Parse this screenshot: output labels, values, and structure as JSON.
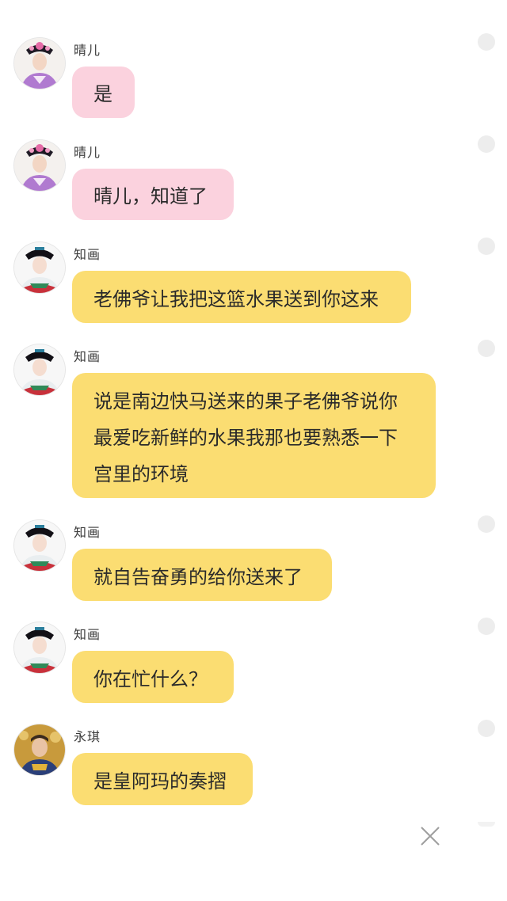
{
  "messages": [
    {
      "sender": "晴儿",
      "text": "是",
      "color": "#fbd2de",
      "avatar": "qinger-avatar"
    },
    {
      "sender": "晴儿",
      "text": "晴儿，知道了",
      "color": "#fbd2de",
      "avatar": "qinger-avatar"
    },
    {
      "sender": "知画",
      "text": "老佛爷让我把这篮水果送到你这来",
      "color": "#fbdd72",
      "avatar": "zhihua-avatar"
    },
    {
      "sender": "知画",
      "lines": [
        "说是南边快马送来的果子老佛爷说你",
        "最爱吃新鲜的水果我那也要熟悉一下",
        "宫里的环境"
      ],
      "color": "#fbdd72",
      "avatar": "zhihua-avatar"
    },
    {
      "sender": "知画",
      "text": "就自告奋勇的给你送来了",
      "color": "#fbdd72",
      "avatar": "zhihua-avatar"
    },
    {
      "sender": "知画",
      "text": "你在忙什么？",
      "color": "#fbdd72",
      "avatar": "zhihua-avatar"
    },
    {
      "sender": "永琪",
      "text": "是皇阿玛的奏摺",
      "color": "#fbdd72",
      "avatar": "yongqi-avatar"
    }
  ],
  "close": {
    "icon": "close-icon"
  }
}
